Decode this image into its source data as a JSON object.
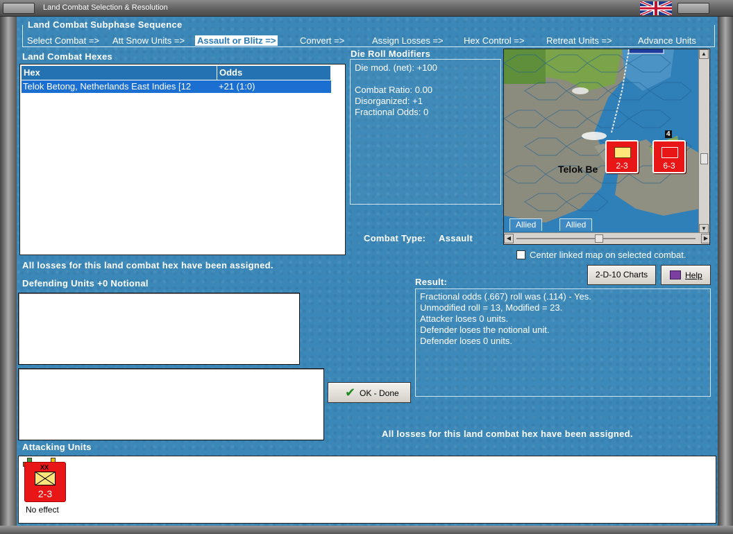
{
  "window": {
    "title": "Land Combat Selection & Resolution"
  },
  "subphase": {
    "title": "Land Combat Subphase Sequence",
    "steps": [
      {
        "label": "Select Combat =>"
      },
      {
        "label": "Att Snow Units =>"
      },
      {
        "label": "Assault or Blitz =>"
      },
      {
        "label": "Convert =>"
      },
      {
        "label": "Assign Losses =>"
      },
      {
        "label": "Hex Control =>"
      },
      {
        "label": "Retreat Units =>"
      },
      {
        "label": "Advance Units"
      }
    ],
    "active_step": "Assault or Blitz =>"
  },
  "hexes": {
    "title": "Land Combat Hexes",
    "columns": [
      "Hex",
      "Odds"
    ],
    "rows": [
      {
        "hex": "Telok Betong, Netherlands East Indies [12",
        "odds": "+21 (1:0)"
      }
    ],
    "losses_note": "All losses for this land combat hex have been assigned."
  },
  "modifiers": {
    "title": "Die Roll Modifiers",
    "lines": [
      "Die mod. (net): +100",
      "Combat Ratio: 0.00",
      "Disorganized: +1",
      "Fractional Odds: 0"
    ]
  },
  "combat_type": {
    "label": "Combat Type:",
    "value": "Assault"
  },
  "map": {
    "city_label": "Telok Be",
    "tabs": [
      "Allied",
      "Allied"
    ],
    "counters": [
      {
        "value": "2-3",
        "color": "#e81616"
      },
      {
        "value": "6-3",
        "color": "#e81616"
      }
    ],
    "stack_count": "4",
    "center_checkbox_label": "Center linked map on selected combat.",
    "center_checkbox_checked": false
  },
  "buttons": {
    "charts": "2-D-10 Charts",
    "help": "Help",
    "ok_done": "OK - Done"
  },
  "defending": {
    "title": "Defending Units +0 Notional"
  },
  "result": {
    "title": "Result:",
    "lines": [
      "Fractional odds (.667) roll was (.114)  - Yes.",
      "Unmodified roll = 13, Modified = 23.",
      "Attacker loses 0 units.",
      "Defender loses the notional unit.",
      "Defender loses 0 units."
    ],
    "losses_note": "All losses for this land combat hex have been assigned."
  },
  "attacking": {
    "title": "Attacking Units",
    "units": [
      {
        "value": "2-3",
        "status": "No effect",
        "size": "XX",
        "color": "#e81616"
      }
    ]
  },
  "colors": {
    "panel_blue": "#3a87b8",
    "header_blue": "#2472b2",
    "selection_blue": "#1a6fd0",
    "counter_red": "#e81616"
  }
}
